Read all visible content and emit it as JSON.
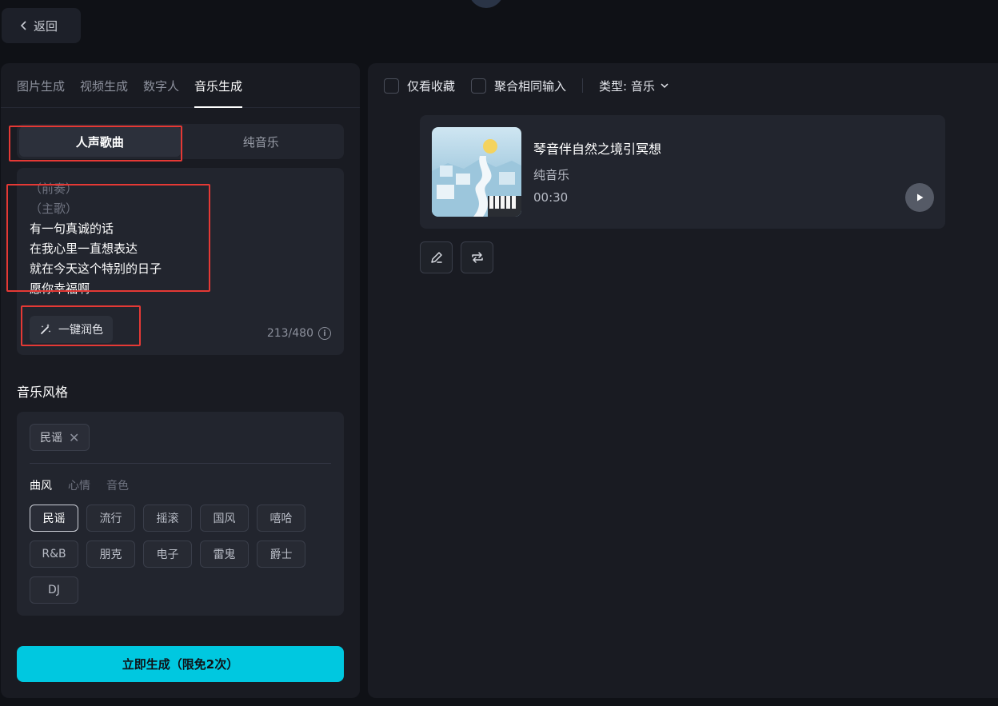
{
  "header": {
    "back_label": "返回"
  },
  "tabs": [
    {
      "label": "图片生成"
    },
    {
      "label": "视频生成"
    },
    {
      "label": "数字人"
    },
    {
      "label": "音乐生成"
    }
  ],
  "mode": {
    "vocal": "人声歌曲",
    "instrumental": "纯音乐",
    "selected": "人声歌曲"
  },
  "lyrics": {
    "lines": [
      {
        "text": "（前奏）",
        "dim": true
      },
      {
        "text": "（主歌）",
        "dim": true
      },
      {
        "text": "有一句真诚的话",
        "dim": false
      },
      {
        "text": "在我心里一直想表达",
        "dim": false
      },
      {
        "text": "就在今天这个特别的日子",
        "dim": false
      },
      {
        "text": "愿你幸福啊",
        "dim": false
      }
    ],
    "polish_label": "一键润色",
    "char_count": "213/480"
  },
  "style": {
    "title": "音乐风格",
    "selected_chip": "民谣",
    "sub_tabs": [
      "曲风",
      "心情",
      "音色"
    ],
    "tags": [
      "民谣",
      "流行",
      "摇滚",
      "国风",
      "嘻哈",
      "R&B",
      "朋克",
      "电子",
      "雷鬼",
      "爵士",
      "DJ"
    ],
    "active_tag": "民谣"
  },
  "generate_label": "立即生成（限免2次）",
  "filters": {
    "favorites_only": "仅看收藏",
    "merge_same_input": "聚合相同输入",
    "type_label": "类型: 音乐"
  },
  "result": {
    "title": "琴音伴自然之境引冥想",
    "type": "纯音乐",
    "duration": "00:30"
  },
  "colors": {
    "accent": "#00c8e0",
    "highlight_box": "#e53935"
  }
}
